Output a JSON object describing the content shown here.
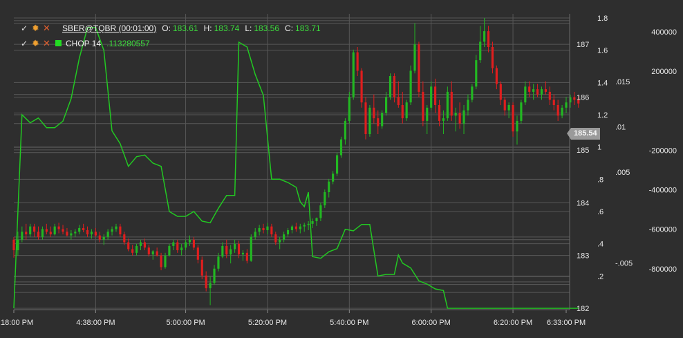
{
  "legend": {
    "symbol": "SBER@TQBR (00:01:00)",
    "o_label": "O:",
    "o_value": "183.61",
    "h_label": "H:",
    "h_value": "183.74",
    "l_label": "L:",
    "l_value": "183.56",
    "c_label": "C:",
    "c_value": "183.71",
    "indicator_name": "CHOP 14",
    "indicator_value": ".113280557"
  },
  "current_price": "185.54",
  "chart_data": {
    "type": "candlestick",
    "colors": {
      "up": "#22b822",
      "down": "#e01e1e",
      "indicator": "#22c822",
      "grid": "#555555",
      "background": "#2e2e2e",
      "text": "#e8e8e8"
    },
    "x_axis": {
      "ticks": [
        "4:18:00 PM",
        "4:38:00 PM",
        "5:00:00 PM",
        "5:20:00 PM",
        "5:40:00 PM",
        "6:00:00 PM",
        "6:20:00 PM",
        "6:33:00 PM"
      ],
      "tick_minutes": [
        0,
        20,
        42,
        62,
        82,
        102,
        122,
        135
      ]
    },
    "price_axis": {
      "range": [
        182,
        187.5
      ],
      "ticks": [
        182,
        183,
        184,
        185,
        186,
        187
      ]
    },
    "chop_axis": {
      "range": [
        0,
        1.8
      ],
      "ticks": [
        "1.8",
        "1.6",
        "1.4",
        "1.2",
        "1",
        ".8",
        ".6",
        ".4",
        ".2"
      ],
      "tick_values": [
        1.8,
        1.6,
        1.4,
        1.2,
        1.0,
        0.8,
        0.6,
        0.4,
        0.2
      ]
    },
    "volume_axis": {
      "range": [
        -1000000,
        470000
      ],
      "ticks": [
        "400000",
        "200000",
        "-200000",
        "-400000",
        "-600000",
        "-800000"
      ],
      "tick_values": [
        400000,
        200000,
        -200000,
        -400000,
        -600000,
        -800000
      ]
    },
    "small_axis": {
      "range": [
        -0.01,
        0.022
      ],
      "ticks": [
        ".015",
        ".01",
        ".005",
        "-.005"
      ],
      "tick_values": [
        0.015,
        0.01,
        0.005,
        -0.005
      ]
    },
    "extra_hlines": [
      187.4,
      187.45,
      186.05,
      185.7,
      185.5,
      185.05,
      184.95,
      183.35,
      183.3,
      182.6,
      182.5,
      182.45,
      182.3
    ],
    "candles": [
      [
        0,
        183.3,
        183.35,
        182.96,
        183.1
      ],
      [
        1,
        183.1,
        183.45,
        183.0,
        183.3
      ],
      [
        2,
        183.3,
        183.55,
        183.25,
        183.45
      ],
      [
        3,
        183.45,
        183.6,
        183.3,
        183.4
      ],
      [
        4,
        183.4,
        183.6,
        183.35,
        183.55
      ],
      [
        5,
        183.55,
        183.6,
        183.35,
        183.45
      ],
      [
        6,
        183.45,
        183.55,
        183.3,
        183.35
      ],
      [
        7,
        183.35,
        183.55,
        183.3,
        183.5
      ],
      [
        8,
        183.5,
        183.6,
        183.4,
        183.45
      ],
      [
        9,
        183.45,
        183.55,
        183.35,
        183.4
      ],
      [
        10,
        183.4,
        183.6,
        183.38,
        183.55
      ],
      [
        11,
        183.55,
        183.62,
        183.42,
        183.5
      ],
      [
        12,
        183.5,
        183.58,
        183.4,
        183.45
      ],
      [
        13,
        183.45,
        183.52,
        183.36,
        183.38
      ],
      [
        14,
        183.38,
        183.48,
        183.3,
        183.42
      ],
      [
        15,
        183.42,
        183.5,
        183.35,
        183.45
      ],
      [
        16,
        183.45,
        183.58,
        183.4,
        183.52
      ],
      [
        17,
        183.52,
        183.6,
        183.44,
        183.48
      ],
      [
        18,
        183.48,
        183.55,
        183.35,
        183.4
      ],
      [
        19,
        183.4,
        183.5,
        183.32,
        183.45
      ],
      [
        20,
        183.45,
        183.52,
        183.35,
        183.38
      ],
      [
        21,
        183.38,
        183.45,
        183.25,
        183.3
      ],
      [
        22,
        183.3,
        183.4,
        183.2,
        183.35
      ],
      [
        23,
        183.35,
        183.5,
        183.3,
        183.45
      ],
      [
        24,
        183.45,
        183.55,
        183.38,
        183.5
      ],
      [
        25,
        183.5,
        183.6,
        183.45,
        183.55
      ],
      [
        26,
        183.55,
        183.6,
        183.35,
        183.4
      ],
      [
        27,
        183.4,
        183.45,
        183.2,
        183.25
      ],
      [
        28,
        183.25,
        183.32,
        183.08,
        183.12
      ],
      [
        29,
        183.12,
        183.2,
        183.0,
        183.05
      ],
      [
        30,
        183.05,
        183.22,
        183.0,
        183.18
      ],
      [
        31,
        183.18,
        183.3,
        183.1,
        183.25
      ],
      [
        32,
        183.25,
        183.32,
        183.1,
        183.15
      ],
      [
        33,
        183.15,
        183.2,
        182.98,
        183.02
      ],
      [
        34,
        183.02,
        183.1,
        182.92,
        183.08
      ],
      [
        35,
        183.08,
        183.15,
        182.98,
        183.0
      ],
      [
        36,
        183.0,
        183.05,
        182.72,
        182.78
      ],
      [
        37,
        182.78,
        183.05,
        182.75,
        183.0
      ],
      [
        38,
        183.0,
        183.22,
        182.98,
        183.18
      ],
      [
        39,
        183.18,
        183.3,
        183.1,
        183.25
      ],
      [
        40,
        183.25,
        183.3,
        183.05,
        183.1
      ],
      [
        41,
        183.1,
        183.22,
        183.0,
        183.15
      ],
      [
        42,
        183.15,
        183.3,
        183.1,
        183.25
      ],
      [
        43,
        183.25,
        183.38,
        183.18,
        183.3
      ],
      [
        44,
        183.3,
        183.35,
        183.1,
        183.15
      ],
      [
        45,
        183.15,
        183.2,
        182.85,
        182.92
      ],
      [
        46,
        182.92,
        182.98,
        182.55,
        182.62
      ],
      [
        47,
        182.62,
        182.7,
        182.32,
        182.38
      ],
      [
        48,
        182.38,
        182.6,
        182.06,
        182.48
      ],
      [
        49,
        182.48,
        182.82,
        182.45,
        182.75
      ],
      [
        50,
        182.75,
        183.05,
        182.7,
        182.98
      ],
      [
        51,
        182.98,
        183.25,
        182.95,
        183.18
      ],
      [
        52,
        183.18,
        183.3,
        182.95,
        183.02
      ],
      [
        53,
        183.02,
        183.2,
        182.85,
        183.12
      ],
      [
        54,
        183.12,
        183.3,
        183.05,
        183.22
      ],
      [
        55,
        183.22,
        183.28,
        182.95,
        183.02
      ],
      [
        56,
        183.02,
        183.1,
        182.9,
        183.05
      ],
      [
        57,
        183.05,
        183.12,
        182.85,
        182.9
      ],
      [
        58,
        182.9,
        183.4,
        182.88,
        183.35
      ],
      [
        59,
        183.35,
        183.52,
        183.3,
        183.45
      ],
      [
        60,
        183.45,
        183.58,
        183.38,
        183.52
      ],
      [
        61,
        183.52,
        183.6,
        183.42,
        183.48
      ],
      [
        62,
        183.48,
        183.62,
        183.4,
        183.55
      ],
      [
        63,
        183.55,
        183.6,
        183.35,
        183.4
      ],
      [
        64,
        183.4,
        183.45,
        183.2,
        183.25
      ],
      [
        65,
        183.25,
        183.35,
        183.12,
        183.3
      ],
      [
        66,
        183.3,
        183.45,
        183.25,
        183.4
      ],
      [
        67,
        183.4,
        183.52,
        183.35,
        183.48
      ],
      [
        68,
        183.48,
        183.58,
        183.42,
        183.55
      ],
      [
        69,
        183.55,
        183.62,
        183.45,
        183.5
      ],
      [
        70,
        183.5,
        183.6,
        183.42,
        183.55
      ],
      [
        71,
        183.55,
        183.62,
        183.45,
        183.58
      ],
      [
        72,
        183.58,
        183.65,
        183.48,
        183.6
      ],
      [
        73,
        183.6,
        183.7,
        183.52,
        183.65
      ],
      [
        74,
        183.65,
        183.72,
        183.56,
        183.71
      ],
      [
        75,
        183.71,
        184.0,
        183.65,
        183.95
      ],
      [
        76,
        183.95,
        184.25,
        183.9,
        184.2
      ],
      [
        77,
        184.2,
        184.45,
        184.1,
        184.4
      ],
      [
        78,
        184.4,
        184.6,
        184.35,
        184.55
      ],
      [
        79,
        184.55,
        184.95,
        184.5,
        184.9
      ],
      [
        80,
        184.9,
        185.25,
        184.85,
        185.2
      ],
      [
        81,
        185.2,
        185.6,
        185.1,
        185.55
      ],
      [
        82,
        185.55,
        186.1,
        185.5,
        186.0
      ],
      [
        83,
        186.0,
        186.9,
        185.95,
        186.85
      ],
      [
        84,
        186.85,
        186.95,
        186.4,
        186.5
      ],
      [
        85,
        186.5,
        186.55,
        185.8,
        185.9
      ],
      [
        86,
        185.9,
        186.0,
        185.2,
        185.3
      ],
      [
        87,
        185.3,
        185.85,
        185.25,
        185.8
      ],
      [
        88,
        185.8,
        186.05,
        185.5,
        185.6
      ],
      [
        89,
        185.6,
        185.75,
        185.3,
        185.45
      ],
      [
        90,
        185.45,
        185.75,
        185.4,
        185.7
      ],
      [
        91,
        185.7,
        186.1,
        185.65,
        186.0
      ],
      [
        92,
        186.0,
        186.45,
        185.95,
        186.4
      ],
      [
        93,
        186.4,
        186.45,
        185.9,
        186.0
      ],
      [
        94,
        186.0,
        186.3,
        185.8,
        185.85
      ],
      [
        95,
        185.85,
        186.1,
        185.5,
        185.6
      ],
      [
        96,
        185.6,
        185.95,
        185.55,
        185.9
      ],
      [
        97,
        185.9,
        186.6,
        185.85,
        186.5
      ],
      [
        98,
        186.5,
        187.4,
        186.45,
        187.0
      ],
      [
        99,
        187.0,
        187.05,
        186.0,
        186.1
      ],
      [
        100,
        186.1,
        186.3,
        185.45,
        185.55
      ],
      [
        101,
        185.55,
        185.85,
        185.3,
        185.8
      ],
      [
        102,
        185.8,
        186.3,
        185.75,
        186.2
      ],
      [
        103,
        186.2,
        186.35,
        185.7,
        185.85
      ],
      [
        104,
        185.85,
        185.95,
        185.45,
        185.55
      ],
      [
        105,
        185.55,
        185.75,
        185.3,
        185.6
      ],
      [
        106,
        185.6,
        186.2,
        185.55,
        186.1
      ],
      [
        107,
        186.1,
        186.3,
        185.55,
        185.65
      ],
      [
        108,
        185.65,
        185.8,
        185.35,
        185.7
      ],
      [
        109,
        185.7,
        185.9,
        185.4,
        185.5
      ],
      [
        110,
        185.5,
        185.85,
        185.3,
        185.75
      ],
      [
        111,
        185.75,
        186.05,
        185.65,
        185.95
      ],
      [
        112,
        185.95,
        186.25,
        185.9,
        186.2
      ],
      [
        113,
        186.2,
        186.8,
        186.15,
        186.7
      ],
      [
        114,
        186.7,
        187.35,
        186.65,
        187.05
      ],
      [
        115,
        187.05,
        187.5,
        186.95,
        187.25
      ],
      [
        116,
        187.25,
        187.35,
        186.85,
        186.95
      ],
      [
        117,
        186.95,
        187.05,
        186.45,
        186.55
      ],
      [
        118,
        186.55,
        186.6,
        186.15,
        186.25
      ],
      [
        119,
        186.25,
        186.3,
        185.85,
        185.95
      ],
      [
        120,
        185.95,
        186.0,
        185.65,
        185.75
      ],
      [
        121,
        185.75,
        185.9,
        185.6,
        185.85
      ],
      [
        122,
        185.85,
        185.9,
        185.25,
        185.35
      ],
      [
        123,
        185.35,
        185.65,
        185.1,
        185.55
      ],
      [
        124,
        185.55,
        185.95,
        185.5,
        185.9
      ],
      [
        125,
        185.9,
        186.3,
        185.85,
        186.2
      ],
      [
        126,
        186.2,
        186.3,
        186.0,
        186.1
      ],
      [
        127,
        186.1,
        186.25,
        185.95,
        186.15
      ],
      [
        128,
        186.15,
        186.25,
        186.0,
        186.05
      ],
      [
        129,
        186.05,
        186.2,
        185.95,
        186.15
      ],
      [
        130,
        186.15,
        186.3,
        186.05,
        186.1
      ],
      [
        131,
        186.1,
        186.2,
        185.85,
        185.95
      ],
      [
        132,
        185.95,
        186.05,
        185.75,
        185.85
      ],
      [
        133,
        185.85,
        185.95,
        185.55,
        185.65
      ],
      [
        134,
        185.65,
        185.85,
        185.6,
        185.8
      ],
      [
        135,
        185.8,
        186.0,
        185.7,
        185.9
      ],
      [
        136,
        185.9,
        186.05,
        185.8,
        186.0
      ],
      [
        137,
        186.0,
        186.1,
        185.85,
        185.95
      ],
      [
        138,
        185.95,
        186.02,
        185.8,
        185.88
      ]
    ],
    "chop": [
      [
        0,
        0.0
      ],
      [
        2,
        1.2
      ],
      [
        4,
        1.15
      ],
      [
        6,
        1.18
      ],
      [
        8,
        1.12
      ],
      [
        10,
        1.12
      ],
      [
        12,
        1.16
      ],
      [
        14,
        1.3
      ],
      [
        16,
        1.55
      ],
      [
        18,
        1.74
      ],
      [
        19,
        1.74
      ],
      [
        20,
        1.74
      ],
      [
        22,
        1.6
      ],
      [
        24,
        1.1
      ],
      [
        26,
        1.02
      ],
      [
        28,
        0.88
      ],
      [
        30,
        0.94
      ],
      [
        32,
        0.95
      ],
      [
        34,
        0.9
      ],
      [
        36,
        0.88
      ],
      [
        38,
        0.6
      ],
      [
        40,
        0.57
      ],
      [
        42,
        0.57
      ],
      [
        44,
        0.6
      ],
      [
        46,
        0.54
      ],
      [
        48,
        0.53
      ],
      [
        50,
        0.62
      ],
      [
        52,
        0.7
      ],
      [
        54,
        0.7
      ],
      [
        55,
        1.65
      ],
      [
        57,
        1.62
      ],
      [
        59,
        1.45
      ],
      [
        61,
        1.32
      ],
      [
        63,
        0.8
      ],
      [
        65,
        0.8
      ],
      [
        67,
        0.78
      ],
      [
        69,
        0.75
      ],
      [
        70,
        0.66
      ],
      [
        71,
        0.63
      ],
      [
        72,
        0.72
      ],
      [
        73,
        0.32
      ],
      [
        75,
        0.31
      ],
      [
        77,
        0.35
      ],
      [
        79,
        0.37
      ],
      [
        81,
        0.49
      ],
      [
        83,
        0.48
      ],
      [
        85,
        0.52
      ],
      [
        87,
        0.52
      ],
      [
        89,
        0.2
      ],
      [
        91,
        0.21
      ],
      [
        93,
        0.21
      ],
      [
        94,
        0.33
      ],
      [
        95,
        0.28
      ],
      [
        97,
        0.25
      ],
      [
        99,
        0.17
      ],
      [
        101,
        0.15
      ],
      [
        103,
        0.12
      ],
      [
        105,
        0.11
      ],
      [
        106,
        0.0
      ],
      [
        110,
        0.0
      ],
      [
        114,
        0.0
      ],
      [
        118,
        0.0
      ],
      [
        122,
        0.0
      ],
      [
        126,
        0.0
      ],
      [
        130,
        0.0
      ],
      [
        134,
        0.0
      ],
      [
        138,
        0.0
      ]
    ]
  }
}
